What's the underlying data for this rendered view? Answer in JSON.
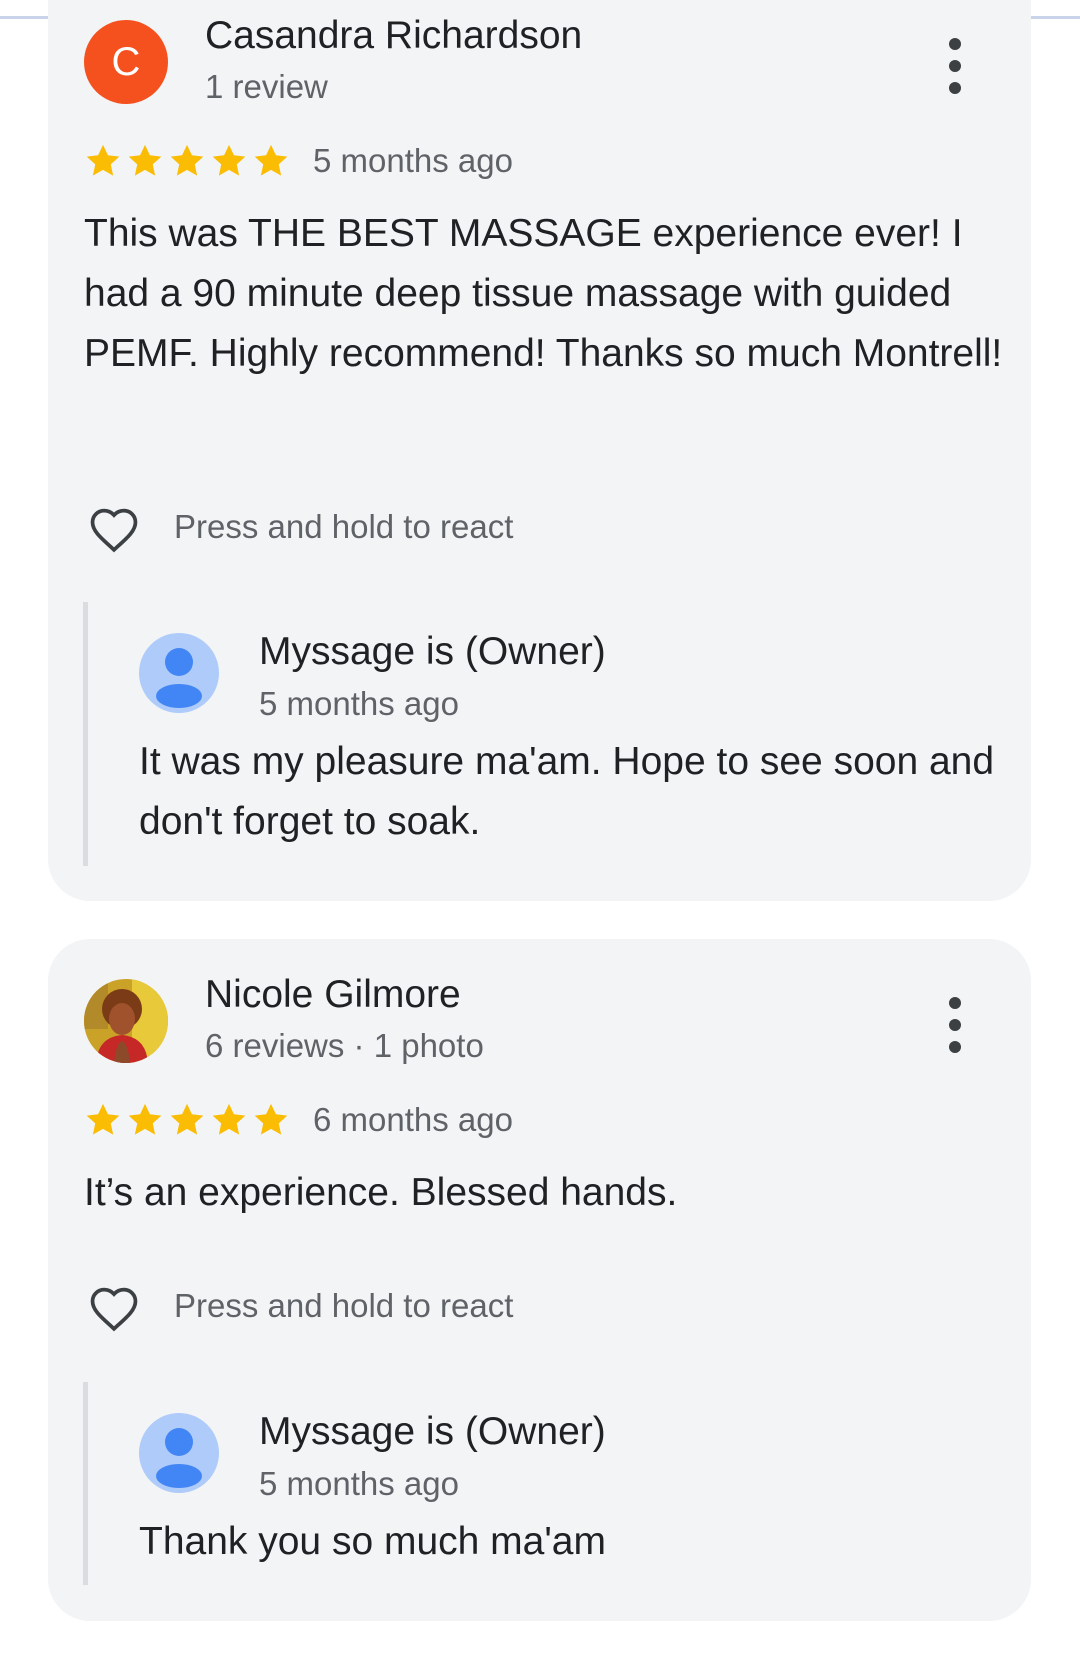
{
  "reviews": [
    {
      "author": {
        "initial": "C",
        "name": "Casandra Richardson",
        "meta": "1 review",
        "avatar_color": "#f4511e"
      },
      "rating": 5,
      "time": "5 months ago",
      "text": "This was THE BEST MASSAGE experience ever! I had a 90 minute deep tissue massage with guided PEMF. Highly recommend! Thanks so much Montrell!",
      "react_label": "Press and hold to react",
      "reply": {
        "name": "Myssage is (Owner)",
        "time": "5 months ago",
        "text": "It was my pleasure ma'am. Hope to see soon and don't forget to soak."
      }
    },
    {
      "author": {
        "name": "Nicole Gilmore",
        "meta": "6 reviews · 1 photo",
        "avatar": "profile-photo"
      },
      "rating": 5,
      "time": "6 months ago",
      "text": "It’s an experience. Blessed hands.",
      "react_label": "Press and hold to react",
      "reply": {
        "name": "Myssage is (Owner)",
        "time": "5 months ago",
        "text": "Thank you so much ma'am"
      }
    }
  ],
  "colors": {
    "star": "#fbbc04",
    "card_bg": "#f3f4f6",
    "owner_avatar_bg": "#aecbfa",
    "owner_avatar_fg": "#4285f4"
  },
  "icons": {
    "more": "more-vert-icon",
    "react": "heart-outline-icon",
    "star": "star-icon",
    "owner_avatar": "person-icon"
  }
}
